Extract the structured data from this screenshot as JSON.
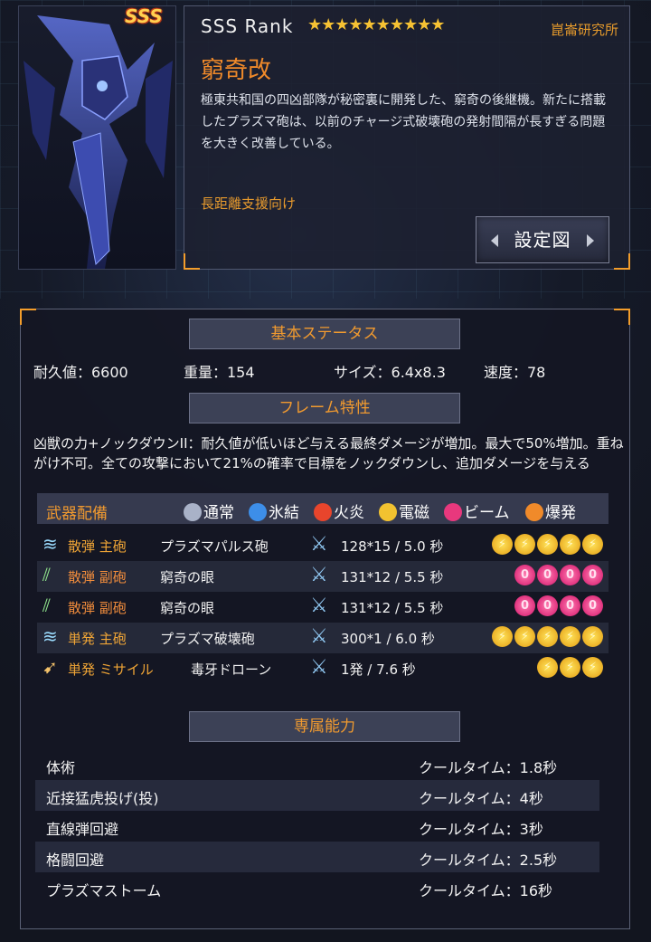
{
  "card": {
    "rank_badge": "SSS",
    "rank_label": "SSS Rank",
    "stars": "★★★★★★★★★★",
    "maker": "崑崙研究所",
    "name": "窮奇改",
    "description": "極東共和国の四凶部隊が秘密裏に開発した、窮奇の後継機。新たに搭載したプラズマ砲は、以前のチャージ式破壊砲の発射間隔が長すぎる問題を大きく改善している。",
    "role": "長距離支援向け",
    "blueprint_button": "設定図"
  },
  "basic_status": {
    "header": "基本ステータス",
    "durability": "耐久値：6600",
    "weight": "重量：154",
    "size": "サイズ：6.4x8.3",
    "speed": "速度：78"
  },
  "frame_traits": {
    "header": "フレーム特性",
    "text": "凶獣の力+ノックダウンII：耐久値が低いほど与える最終ダメージが増加。最大で50%増加。重ねがけ不可。全ての攻撃において21%の確率で目標をノックダウンし、追加ダメージを与える"
  },
  "weapons": {
    "header": "武器配備",
    "legend": [
      {
        "label": "通常",
        "color": "#a9b2c8"
      },
      {
        "label": "氷結",
        "color": "#3d8ee8"
      },
      {
        "label": "火炎",
        "color": "#e8452c"
      },
      {
        "label": "電磁",
        "color": "#f2c230"
      },
      {
        "label": "ビーム",
        "color": "#e8387d"
      },
      {
        "label": "爆発",
        "color": "#f08a2a"
      }
    ],
    "rows": [
      {
        "type": "散弾 主砲",
        "name": "プラズマパルス砲",
        "value": "128*15 / 5.0 秒",
        "element": "elec",
        "count": 5
      },
      {
        "type": "散弾 副砲",
        "name": "窮奇の眼",
        "value": "131*12 / 5.5 秒",
        "element": "beam",
        "count": 4
      },
      {
        "type": "散弾 副砲",
        "name": "窮奇の眼",
        "value": "131*12 / 5.5 秒",
        "element": "beam",
        "count": 4
      },
      {
        "type": "単発 主砲",
        "name": "プラズマ破壊砲",
        "value": "300*1 / 6.0 秒",
        "element": "elec",
        "count": 5
      },
      {
        "type": "単発 ミサイル",
        "name": "毒牙ドローン",
        "value": "1発 / 7.6 秒",
        "element": "elec",
        "count": 3
      }
    ]
  },
  "abilities": {
    "header": "専属能力",
    "rows": [
      {
        "name": "体術",
        "cooldown": "クールタイム：1.8秒"
      },
      {
        "name": "近接猛虎投げ(投)",
        "cooldown": "クールタイム：4秒"
      },
      {
        "name": "直線弾回避",
        "cooldown": "クールタイム：3秒"
      },
      {
        "name": "格闘回避",
        "cooldown": "クールタイム：2.5秒"
      },
      {
        "name": "プラズマストーム",
        "cooldown": "クールタイム：16秒"
      }
    ]
  }
}
